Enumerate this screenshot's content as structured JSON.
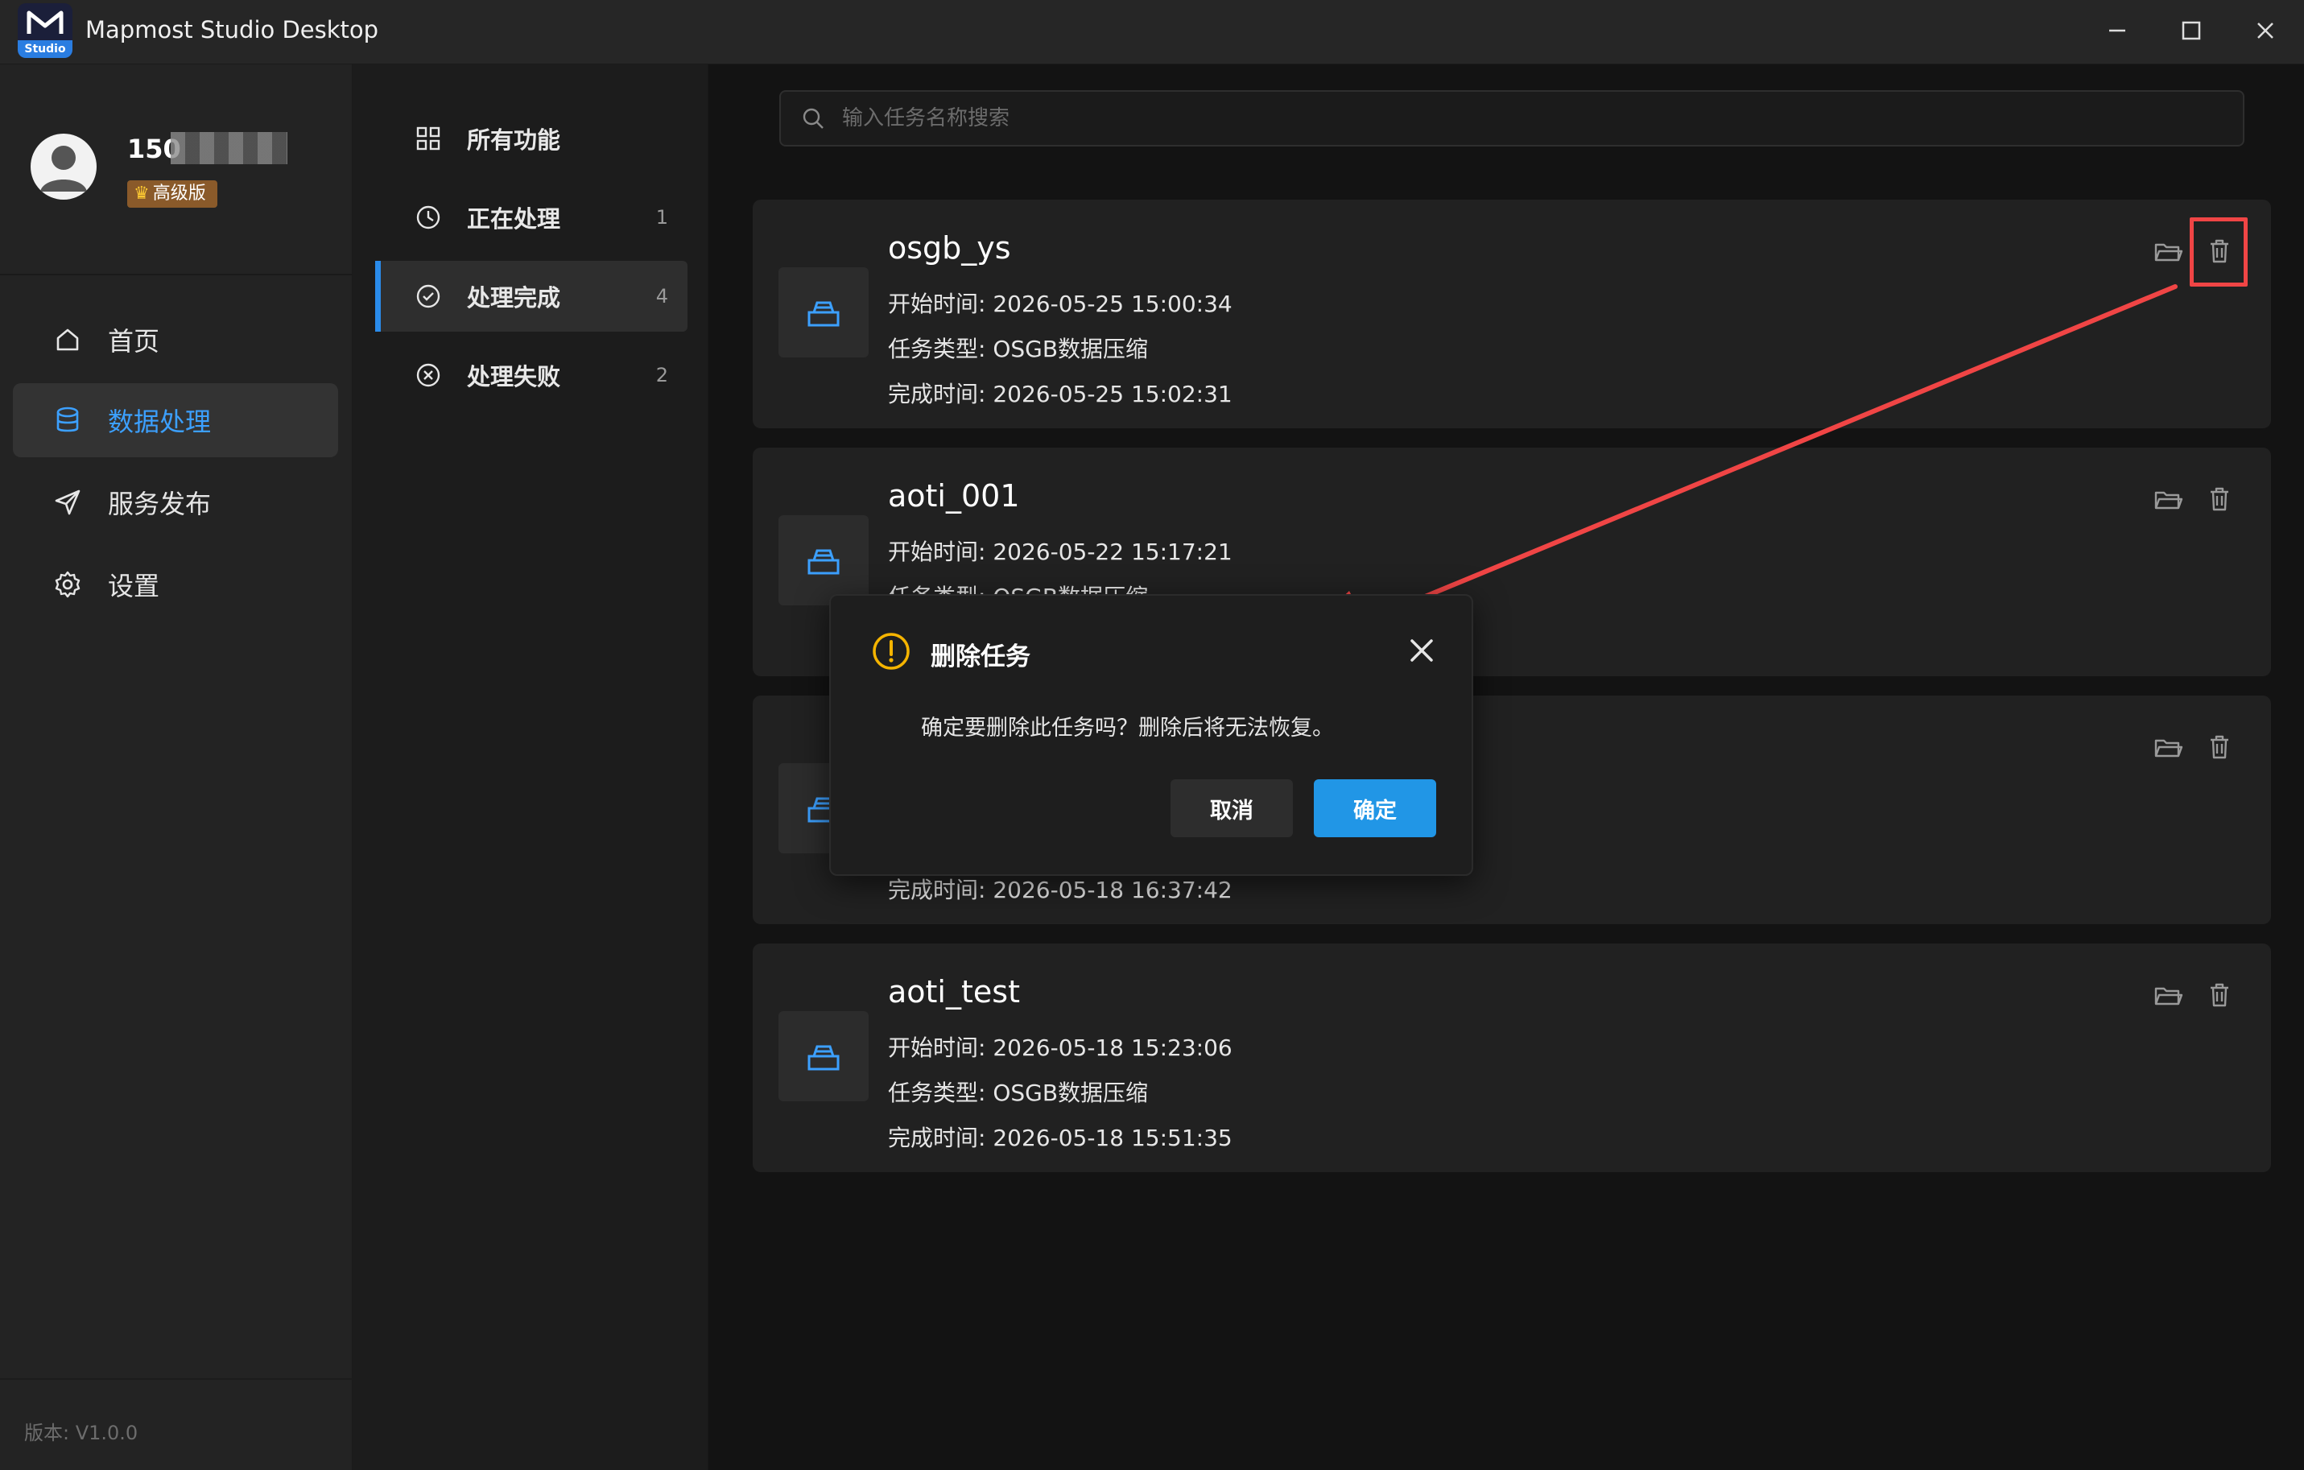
{
  "window": {
    "title": "Mapmost Studio Desktop",
    "logo_tag": "Studio"
  },
  "user": {
    "name": "150",
    "badge": "高级版"
  },
  "sidebar": {
    "items": [
      {
        "label": "首页",
        "icon": "home-icon"
      },
      {
        "label": "数据处理",
        "icon": "database-icon",
        "active": true
      },
      {
        "label": "服务发布",
        "icon": "send-icon"
      },
      {
        "label": "设置",
        "icon": "gear-icon"
      }
    ],
    "version": "版本: V1.0.0"
  },
  "subnav": {
    "items": [
      {
        "label": "所有功能",
        "icon": "grid-icon",
        "count": ""
      },
      {
        "label": "正在处理",
        "icon": "clock-icon",
        "count": "1"
      },
      {
        "label": "处理完成",
        "icon": "check-circle-icon",
        "count": "4",
        "active": true
      },
      {
        "label": "处理失败",
        "icon": "x-circle-icon",
        "count": "2"
      }
    ]
  },
  "search": {
    "placeholder": "输入任务名称搜索"
  },
  "tasks": [
    {
      "name": "osgb_ys",
      "start": "开始时间: 2026-05-25 15:00:34",
      "type": "任务类型: OSGB数据压缩",
      "end": "完成时间: 2026-05-25 15:02:31"
    },
    {
      "name": "aoti_001",
      "start": "开始时间: 2026-05-22 15:17:21",
      "type": "任务类型: OSGB数据压缩",
      "end": ""
    },
    {
      "name": "",
      "start": "",
      "type": "",
      "end": "完成时间: 2026-05-18 16:37:42"
    },
    {
      "name": "aoti_test",
      "start": "开始时间: 2026-05-18 15:23:06",
      "type": "任务类型: OSGB数据压缩",
      "end": "完成时间: 2026-05-18 15:51:35"
    }
  ],
  "dialog": {
    "title": "删除任务",
    "message": "确定要删除此任务吗？删除后将无法恢复。",
    "cancel": "取消",
    "confirm": "确定"
  },
  "colors": {
    "accent": "#2196e6",
    "warning": "#f5b400",
    "annotation": "#f04545"
  }
}
